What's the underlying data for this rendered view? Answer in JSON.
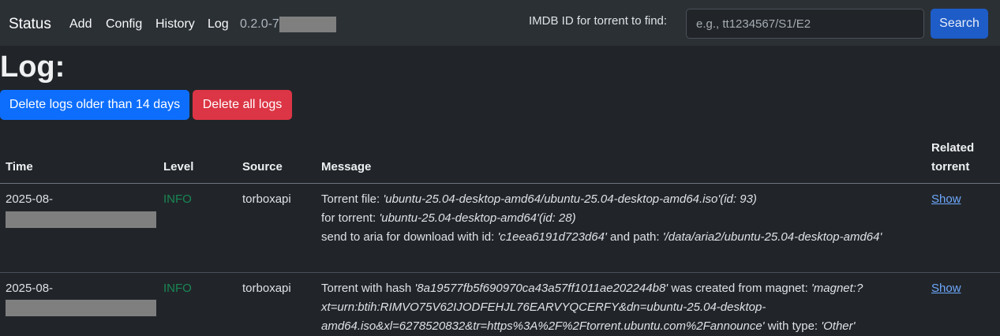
{
  "navbar": {
    "brand": "Status",
    "links": [
      "Add",
      "Config",
      "History",
      "Log"
    ],
    "version": "0.2.0-7"
  },
  "search": {
    "label": "IMDB ID for torrent to find:",
    "placeholder": "e.g., tt1234567/S1/E2",
    "button": "Search"
  },
  "page": {
    "title": "Log:",
    "buttons": {
      "delete_old": "Delete logs older than 14 days",
      "delete_all": "Delete all logs"
    }
  },
  "table": {
    "headers": {
      "time": "Time",
      "level": "Level",
      "source": "Source",
      "message": "Message",
      "related_line1": "Related",
      "related_line2": "torrent"
    },
    "rows": [
      {
        "time": "2025-08-",
        "level": "INFO",
        "source": "torboxapi",
        "message": [
          {
            "t": "Torrent file: ",
            "i": false
          },
          {
            "t": "'ubuntu-25.04-desktop-amd64/ubuntu-25.04-desktop-amd64.iso'",
            "i": true
          },
          {
            "t": "(id: 93)",
            "i": true
          },
          {
            "t": "\n",
            "i": false
          },
          {
            "t": "for torrent: ",
            "i": false
          },
          {
            "t": "'ubuntu-25.04-desktop-amd64'",
            "i": true
          },
          {
            "t": "(id: 28)",
            "i": true
          },
          {
            "t": "\n",
            "i": false
          },
          {
            "t": "send to aria for download with id: ",
            "i": false
          },
          {
            "t": "'c1eea6191d723d64'",
            "i": true
          },
          {
            "t": " and path: ",
            "i": false
          },
          {
            "t": "'/data/aria2/ubuntu-25.04-desktop-amd64'",
            "i": true
          }
        ],
        "related": "Show"
      },
      {
        "time": "2025-08-",
        "level": "INFO",
        "source": "torboxapi",
        "message": [
          {
            "t": "Torrent with hash ",
            "i": false
          },
          {
            "t": "'8a19577fb5f690970ca43a57ff1011ae202244b8'",
            "i": true
          },
          {
            "t": " was created from magnet: ",
            "i": false
          },
          {
            "t": "'magnet:?xt=urn:btih:RIMVO75V62IJODFEHJL76EARVYQCERFY&dn=ubuntu-25.04-desktop-amd64.iso&xl=6278520832&tr=https%3A%2F%2Ftorrent.ubuntu.com%2Fannounce'",
            "i": true
          },
          {
            "t": " with type: ",
            "i": false
          },
          {
            "t": "'Other'",
            "i": true
          }
        ],
        "related": "Show"
      }
    ]
  }
}
